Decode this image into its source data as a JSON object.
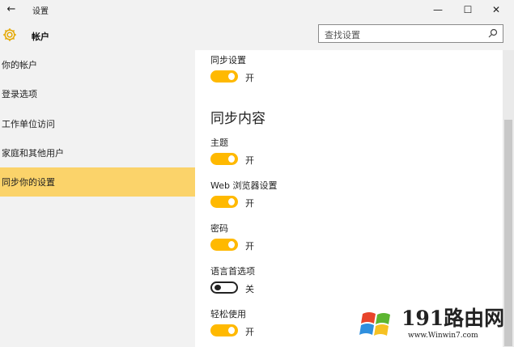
{
  "window": {
    "title": "设置",
    "controls": {
      "minimize": "—",
      "maximize": "☐",
      "close": "✕"
    },
    "back_glyph": "←"
  },
  "header": {
    "title": "帐户",
    "icon": "gear-icon",
    "search": {
      "placeholder": "查找设置",
      "icon": "search-icon"
    }
  },
  "sidebar": {
    "items": [
      {
        "label": "你的帐户",
        "active": false
      },
      {
        "label": "登录选项",
        "active": false
      },
      {
        "label": "工作单位访问",
        "active": false
      },
      {
        "label": "家庭和其他用户",
        "active": false
      },
      {
        "label": "同步你的设置",
        "active": true
      }
    ]
  },
  "main": {
    "sync_settings": {
      "label": "同步设置",
      "state": "开",
      "on": true
    },
    "section_title": "同步内容",
    "toggles": [
      {
        "label": "主题",
        "state": "开",
        "on": true
      },
      {
        "label": "Web 浏览器设置",
        "state": "开",
        "on": true
      },
      {
        "label": "密码",
        "state": "开",
        "on": true
      },
      {
        "label": "语言首选项",
        "state": "关",
        "on": false
      },
      {
        "label": "轻松使用",
        "state": "开",
        "on": true
      }
    ]
  },
  "watermark": {
    "text": "191路由网",
    "url": "www.Winwin7.com"
  },
  "colors": {
    "accent": "#ffb900",
    "active_item": "#fbd36a",
    "chrome": "#f2f2f2"
  }
}
